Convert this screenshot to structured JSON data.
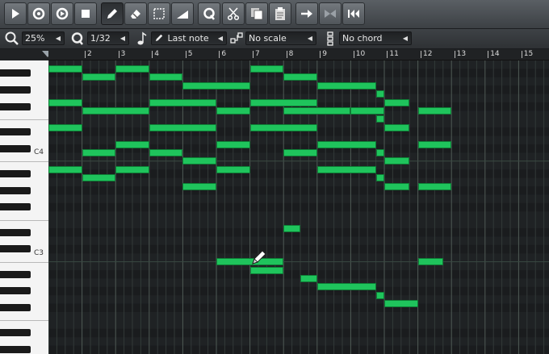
{
  "toolbar": {
    "buttons": [
      {
        "icon": "play-icon",
        "active": false
      },
      {
        "icon": "record-icon",
        "active": false
      },
      {
        "icon": "record-while-playing-icon",
        "active": false
      },
      {
        "icon": "stop-icon",
        "active": false
      },
      {
        "icon": "pencil-draw-icon",
        "active": true
      },
      {
        "icon": "eraser-icon",
        "active": false
      },
      {
        "icon": "select-icon",
        "active": false
      },
      {
        "icon": "detune-icon",
        "active": false
      },
      {
        "icon": "quantize-icon",
        "active": false
      },
      {
        "icon": "cut-icon",
        "active": false
      },
      {
        "icon": "copy-icon",
        "active": false
      },
      {
        "icon": "paste-icon",
        "active": false
      },
      {
        "icon": "stitch-icon",
        "active": false
      },
      {
        "icon": "knife-icon",
        "active": false
      },
      {
        "icon": "rewind-start-icon",
        "active": false
      }
    ]
  },
  "options": {
    "zoom": "25%",
    "quantize": "1/32",
    "note_length": "Last note",
    "scale": "No scale",
    "chord": "No chord"
  },
  "ruler": {
    "bars": [
      "2",
      "3",
      "4",
      "5",
      "6",
      "7",
      "8",
      "9",
      "10",
      "11",
      "12",
      "13",
      "14",
      "15"
    ]
  },
  "piano": {
    "labels": [
      "C4",
      "C3"
    ]
  },
  "colors": {
    "note": "#1fc45c",
    "note_border": "#0f7a35"
  },
  "notes": [
    {
      "pitch": -1,
      "start": 0,
      "len": 1
    },
    {
      "pitch": -1,
      "start": 2,
      "len": 1
    },
    {
      "pitch": -1,
      "start": 6,
      "len": 1
    },
    {
      "pitch": -2,
      "start": 1,
      "len": 1
    },
    {
      "pitch": -2,
      "start": 3,
      "len": 1
    },
    {
      "pitch": -2,
      "start": 7,
      "len": 1
    },
    {
      "pitch": -3,
      "start": 4,
      "len": 2
    },
    {
      "pitch": -3,
      "start": 8,
      "len": 1.75
    },
    {
      "pitch": -4,
      "start": 9.75,
      "len": 0.25
    },
    {
      "pitch": -5,
      "start": 0,
      "len": 1
    },
    {
      "pitch": -5,
      "start": 3,
      "len": 2
    },
    {
      "pitch": -5,
      "start": 6,
      "len": 2
    },
    {
      "pitch": -5,
      "start": 10,
      "len": 0.75
    },
    {
      "pitch": -6,
      "start": 1,
      "len": 2
    },
    {
      "pitch": -6,
      "start": 5,
      "len": 1
    },
    {
      "pitch": -6,
      "start": 7,
      "len": 2
    },
    {
      "pitch": -6,
      "start": 9,
      "len": 1
    },
    {
      "pitch": -6,
      "start": 11,
      "len": 1
    },
    {
      "pitch": -7,
      "start": 9.75,
      "len": 0.25
    },
    {
      "pitch": -8,
      "start": 0,
      "len": 1
    },
    {
      "pitch": -8,
      "start": 3,
      "len": 2
    },
    {
      "pitch": -8,
      "start": 6,
      "len": 2
    },
    {
      "pitch": -8,
      "start": 10,
      "len": 0.75
    },
    {
      "pitch": -10,
      "start": 2,
      "len": 1
    },
    {
      "pitch": -10,
      "start": 5,
      "len": 1
    },
    {
      "pitch": -10,
      "start": 8,
      "len": 1.75
    },
    {
      "pitch": -10,
      "start": 11,
      "len": 1
    },
    {
      "pitch": -11,
      "start": 1,
      "len": 1
    },
    {
      "pitch": -11,
      "start": 3,
      "len": 1
    },
    {
      "pitch": -11,
      "start": 7,
      "len": 1
    },
    {
      "pitch": -11,
      "start": 9.75,
      "len": 0.25
    },
    {
      "pitch": -12,
      "start": 4,
      "len": 1
    },
    {
      "pitch": -12,
      "start": 10,
      "len": 0.75
    },
    {
      "pitch": -13,
      "start": 0,
      "len": 1
    },
    {
      "pitch": -13,
      "start": 2,
      "len": 1
    },
    {
      "pitch": -13,
      "start": 5,
      "len": 1
    },
    {
      "pitch": -13,
      "start": 8,
      "len": 1.75
    },
    {
      "pitch": -14,
      "start": 1,
      "len": 1
    },
    {
      "pitch": -14,
      "start": 9.75,
      "len": 0.25
    },
    {
      "pitch": -15,
      "start": 4,
      "len": 1
    },
    {
      "pitch": -15,
      "start": 10,
      "len": 0.75
    },
    {
      "pitch": -15,
      "start": 11,
      "len": 1
    },
    {
      "pitch": -20,
      "start": 7,
      "len": 0.5
    },
    {
      "pitch": -24,
      "start": 5,
      "len": 2
    },
    {
      "pitch": -24,
      "start": 11,
      "len": 0.75
    },
    {
      "pitch": -25,
      "start": 6,
      "len": 1
    },
    {
      "pitch": -26,
      "start": 7.5,
      "len": 0.5
    },
    {
      "pitch": -27,
      "start": 8,
      "len": 1.75
    },
    {
      "pitch": -28,
      "start": 9.75,
      "len": 0.25
    },
    {
      "pitch": -29,
      "start": 10,
      "len": 1
    }
  ]
}
